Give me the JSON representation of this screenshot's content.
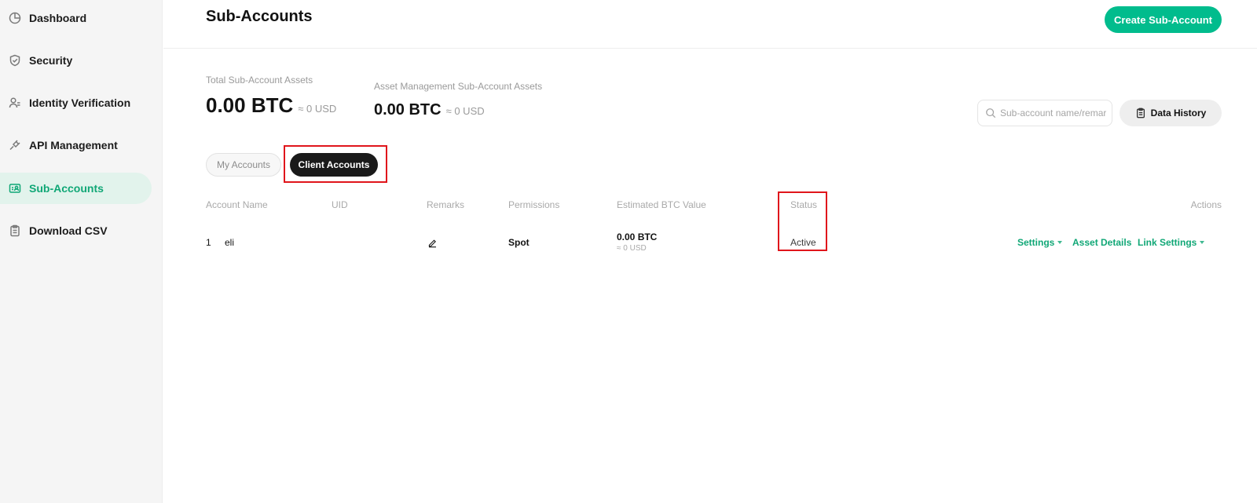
{
  "sidebar": {
    "items": [
      {
        "label": "Dashboard",
        "icon": "dashboard-icon"
      },
      {
        "label": "Security",
        "icon": "shield-icon"
      },
      {
        "label": "Identity Verification",
        "icon": "user-icon"
      },
      {
        "label": "API Management",
        "icon": "api-plug-icon"
      },
      {
        "label": "Sub-Accounts",
        "icon": "sub-accounts-icon",
        "active": true
      },
      {
        "label": "Download CSV",
        "icon": "clipboard-icon"
      }
    ]
  },
  "header": {
    "title": "Sub-Accounts",
    "create_button": "Create Sub-Account"
  },
  "assets": {
    "total": {
      "label": "Total Sub-Account Assets",
      "value": "0.00 BTC",
      "usd": "≈ 0 USD"
    },
    "asset_management": {
      "label": "Asset Management Sub-Account Assets",
      "value": "0.00 BTC",
      "usd": "≈ 0 USD"
    }
  },
  "search": {
    "placeholder": "Sub-account name/remarks",
    "value": ""
  },
  "data_history_button": "Data History",
  "tabs": [
    {
      "label": "My Accounts",
      "active": false
    },
    {
      "label": "Client Accounts",
      "active": true
    }
  ],
  "table": {
    "headers": {
      "account_name": "Account Name",
      "uid": "UID",
      "remarks": "Remarks",
      "permissions": "Permissions",
      "btc_value": "Estimated BTC Value",
      "status": "Status",
      "actions": "Actions"
    },
    "rows": [
      {
        "index": "1",
        "account_name": "eli",
        "uid": "",
        "remarks_icon": "edit-icon",
        "permissions": "Spot",
        "btc_value": "0.00 BTC",
        "btc_usd": "≈ 0 USD",
        "status": "Active",
        "actions": [
          "Settings",
          "Asset Details",
          "Link Settings"
        ]
      }
    ]
  },
  "colors": {
    "accent": "#01bc8d",
    "accent_text": "#10a776",
    "highlight": "#e0151b",
    "active_nav_bg": "#e2f3ec"
  }
}
